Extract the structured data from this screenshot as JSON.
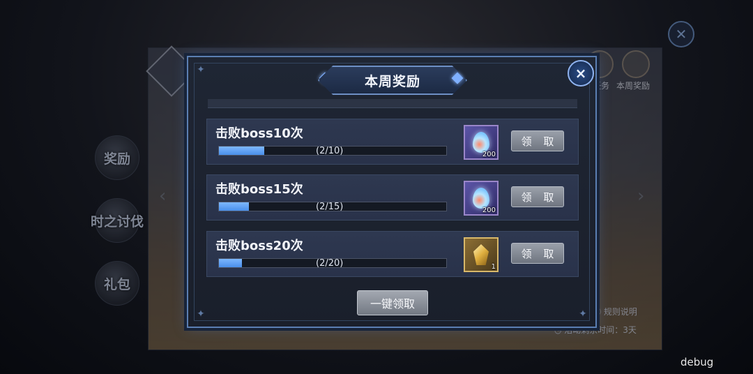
{
  "background": {
    "side_menu": [
      "奖励",
      "时之讨伐",
      "礼包"
    ],
    "top_labels": [
      "任务",
      "本周奖励"
    ],
    "rules_label": "规则说明",
    "time_remaining": "活动剩余时间：3天"
  },
  "dialog": {
    "title": "本周奖励",
    "close_icon": "×",
    "rows": [
      {
        "title": "击败boss10次",
        "progress_text": "(2/10)",
        "progress": 0.2,
        "reward_icon": "crystal-drop-icon",
        "reward_count": "200",
        "claim_label": "领 取"
      },
      {
        "title": "击败boss15次",
        "progress_text": "(2/15)",
        "progress": 0.1333,
        "reward_icon": "crystal-drop-icon",
        "reward_count": "200",
        "claim_label": "领 取"
      },
      {
        "title": "击败boss20次",
        "progress_text": "(2/20)",
        "progress": 0.1,
        "reward_icon": "gold-crystal-icon",
        "reward_count": "1",
        "claim_label": "领 取"
      }
    ],
    "claim_all_label": "一键领取"
  },
  "debug_label": "debug",
  "colors": {
    "dialog_border": "#5b7fb3",
    "progress_fill": "#4a8fea",
    "button_gray": "#8a909a"
  }
}
